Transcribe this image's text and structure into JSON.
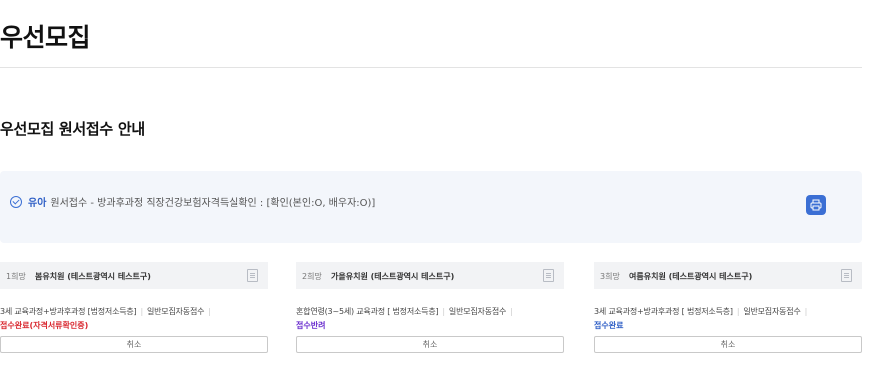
{
  "page": {
    "title": "우선모집"
  },
  "section": {
    "title": "우선모집 원서접수 안내"
  },
  "info": {
    "child_name": "유아",
    "text": "원서접수 - 방과후과정 직장건강보험자격득실확인 : [확인(본인:O, 배우자:O)]",
    "print_icon": "printer-icon",
    "accent_color": "#3b6fd4"
  },
  "cards": [
    {
      "rank": "1희망",
      "school": "봄유치원 (테스트광역시 테스트구)",
      "course": "3세 교육과정+방과후과정 [법정저소득층]",
      "type": "일반모집자동접수",
      "status": "접수완료(자격서류확인중)",
      "status_color": "#d9282f",
      "cancel_label": "취소"
    },
    {
      "rank": "2희망",
      "school": "가을유치원 (테스트광역시 테스트구)",
      "course": "혼합연령(3~5세) 교육과정 [ 법정저소득층]",
      "type": "일반모집자동접수",
      "status": "접수반려",
      "status_color": "#6b2fcf",
      "cancel_label": "취소"
    },
    {
      "rank": "3희망",
      "school": "여름유치원 (테스트광역시 테스트구)",
      "course": "3세 교육과정+방과후과정 [ 법정저소득층]",
      "type": "일반모집자동접수",
      "status": "접수완료",
      "status_color": "#2f5fc6",
      "cancel_label": "취소"
    }
  ]
}
